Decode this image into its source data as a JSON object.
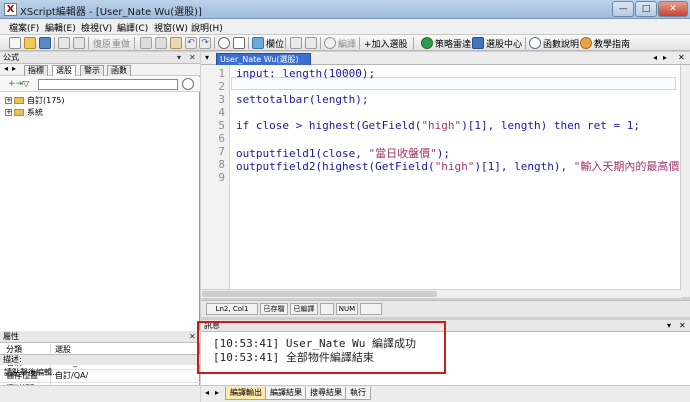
{
  "window": {
    "title": "XScript編輯器 - [User_Nate Wu(選股)]",
    "app_icon": "X"
  },
  "menu": [
    "檔案(F)",
    "編輯(E)",
    "檢視(V)",
    "編譯(C)",
    "視窗(W)",
    "說明(H)"
  ],
  "toolbar": {
    "undo": "復原",
    "redo": "重做",
    "position": "欄位",
    "compile": "編譯",
    "add_selection": "+加入選股",
    "radar": "策略雷達",
    "stock_center": "選股中心",
    "func_lookup": "函數說明",
    "teaching": "教學指南"
  },
  "left_panel": {
    "header": "公式",
    "tabs": [
      "指標",
      "選股",
      "警示",
      "函數"
    ],
    "active_tab": "選股",
    "search": {
      "value": "",
      "placeholder": ""
    },
    "tree": [
      {
        "label": "自訂(175)"
      },
      {
        "label": "系統"
      }
    ]
  },
  "properties": {
    "header": "屬性",
    "rows": [
      {
        "key": "分類",
        "value": "選股"
      },
      {
        "key": "名稱",
        "value": "User_Nate Wu"
      },
      {
        "key": "儲存位置",
        "value": "自訂/QA/"
      },
      {
        "key": "資料讀取",
        "value": ""
      }
    ],
    "desc_header": "描述:",
    "desc_text": "請點擊後編輯..."
  },
  "editor": {
    "tab": "User_Nate Wu(選股)",
    "lines": [
      {
        "n": "1",
        "segments": [
          {
            "t": "input: length(10000);",
            "s": false
          }
        ]
      },
      {
        "n": "2",
        "segments": []
      },
      {
        "n": "3",
        "segments": [
          {
            "t": "settotalbar(length);",
            "s": false
          }
        ]
      },
      {
        "n": "4",
        "segments": []
      },
      {
        "n": "5",
        "segments": [
          {
            "t": "if close > highest(GetField(",
            "s": false
          },
          {
            "t": "\"high\"",
            "s": true
          },
          {
            "t": ")[1], length) then ret = 1;",
            "s": false
          }
        ]
      },
      {
        "n": "6",
        "segments": []
      },
      {
        "n": "7",
        "segments": [
          {
            "t": "outputfield1(close, ",
            "s": false
          },
          {
            "t": "\"當日收盤價\"",
            "s": true
          },
          {
            "t": ");",
            "s": false
          }
        ]
      },
      {
        "n": "8",
        "segments": [
          {
            "t": "outputfield2(highest(GetField(",
            "s": false
          },
          {
            "t": "\"high\"",
            "s": true
          },
          {
            "t": ")[1], length), ",
            "s": false
          },
          {
            "t": "\"輸入天期內的最高價",
            "s": true
          }
        ]
      },
      {
        "n": "9",
        "segments": []
      }
    ]
  },
  "status": {
    "position": "Ln2, Col1",
    "saved": "已存檔",
    "compiled": "已編譯",
    "num": "NUM"
  },
  "messages": {
    "header": "訊息",
    "lines": [
      "[10:53:41] User_Nate Wu 編譯成功",
      "[10:53:41] 全部物件編譯結束"
    ]
  },
  "bottom_tabs": [
    "編譯輸出",
    "編譯結果",
    "搜尋結果",
    "執行"
  ],
  "colors": {
    "highlight": "#cf1a1a",
    "doc_tab": "#3a6fd0",
    "code": "#1a1a9e",
    "string": "#a0356b"
  }
}
